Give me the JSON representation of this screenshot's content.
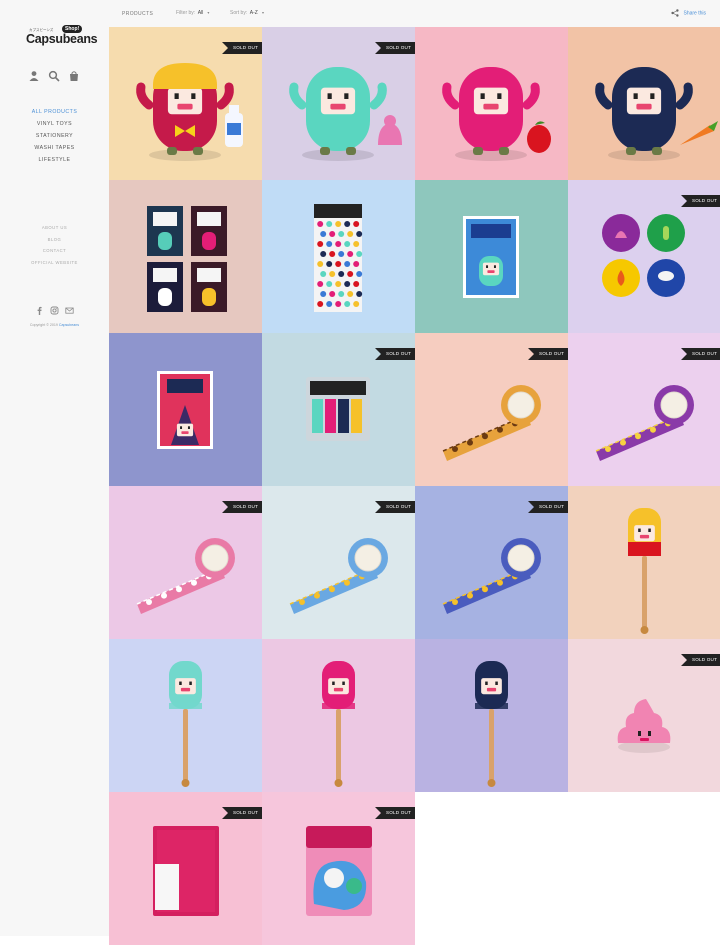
{
  "brand": {
    "logo_text": "Capsubeans",
    "logo_small": "カプスビーンズ",
    "badge": "Shop!"
  },
  "sidebar": {
    "nav": [
      {
        "label": "ALL PRODUCTS",
        "active": true
      },
      {
        "label": "VINYL TOYS",
        "active": false
      },
      {
        "label": "STATIONERY",
        "active": false
      },
      {
        "label": "WASHI TAPES",
        "active": false
      },
      {
        "label": "LIFESTYLE",
        "active": false
      }
    ],
    "subnav": [
      "ABOUT US",
      "BLOG",
      "CONTACT",
      "OFFICIAL WEBSITE"
    ],
    "copyright": "Copyright © 2019",
    "copyright_link": "Capsubeans",
    "icons": [
      "user-icon",
      "search-icon",
      "bag-icon"
    ],
    "social": [
      "facebook-icon",
      "instagram-icon",
      "mail-icon"
    ]
  },
  "topbar": {
    "products": "PRODUCTS",
    "filter_label": "Filter by:",
    "filter_value": "All",
    "sort_label": "Sort by:",
    "sort_value": "A-Z",
    "share": "Share this"
  },
  "sold_out_label": "SOLD OUT",
  "products": [
    {
      "kind": "figure-yellow",
      "bg": "#f6dcae",
      "sold_out": true
    },
    {
      "kind": "figure-mint",
      "bg": "#d9cfe6",
      "sold_out": true
    },
    {
      "kind": "figure-pink",
      "bg": "#f6b8c5",
      "sold_out": false
    },
    {
      "kind": "figure-navy",
      "bg": "#f2c3a6",
      "sold_out": false
    },
    {
      "kind": "postcards",
      "bg": "#e6c8c0",
      "sold_out": false
    },
    {
      "kind": "sticker-sheet",
      "bg": "#c0dcf6",
      "sold_out": false
    },
    {
      "kind": "card-birthday",
      "bg": "#8ec7bd",
      "sold_out": false
    },
    {
      "kind": "badges",
      "bg": "#dcd0ee",
      "sold_out": true
    },
    {
      "kind": "card-cake",
      "bg": "#8e95cd",
      "sold_out": false
    },
    {
      "kind": "sticky-notes",
      "bg": "#c2dae2",
      "sold_out": true
    },
    {
      "kind": "tape-orange",
      "bg": "#f6cdc0",
      "sold_out": true
    },
    {
      "kind": "tape-purple",
      "bg": "#ecd0ee",
      "sold_out": true
    },
    {
      "kind": "tape-pink",
      "bg": "#ecc8e6",
      "sold_out": true
    },
    {
      "kind": "tape-blue",
      "bg": "#dce8ec",
      "sold_out": true
    },
    {
      "kind": "tape-navy",
      "bg": "#a6b2e2",
      "sold_out": true
    },
    {
      "kind": "pen-yellow",
      "bg": "#f2d2bd",
      "sold_out": false
    },
    {
      "kind": "pen-mint",
      "bg": "#ccd5f4",
      "sold_out": false
    },
    {
      "kind": "pen-pink",
      "bg": "#ecc8e3",
      "sold_out": false
    },
    {
      "kind": "pen-navy",
      "bg": "#b9b2e2",
      "sold_out": false
    },
    {
      "kind": "poop",
      "bg": "#f2d8dd",
      "sold_out": true
    },
    {
      "kind": "notebook",
      "bg": "#f7c0d4",
      "sold_out": true
    },
    {
      "kind": "sticker-pack",
      "bg": "#f6c6dc",
      "sold_out": true
    }
  ],
  "colors": {
    "accent": "#4a8fd6",
    "sold_tag": "#222222"
  }
}
